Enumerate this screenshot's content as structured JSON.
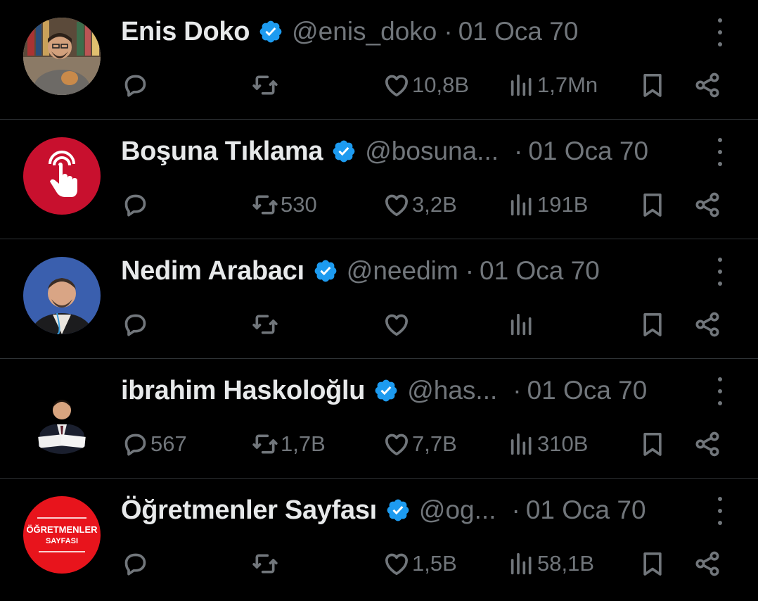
{
  "colors": {
    "background": "#000000",
    "text_primary": "#e7e9ea",
    "text_secondary": "#71767b",
    "verified": "#1d9bf0",
    "divider": "#2f3336"
  },
  "tweets": [
    {
      "name": "Enis Doko",
      "handle": "@enis_doko",
      "separator": "·",
      "date": "01 Oca 70",
      "avatar": "person-photo-bookshelf",
      "replies": "",
      "retweets": "",
      "likes": "10,8B",
      "views": "1,7Mn"
    },
    {
      "name": "Boşuna Tıklama",
      "handle": "@bosuna...",
      "separator": "·",
      "date": "01 Oca 70",
      "avatar": "red-hand-click-logo",
      "replies": "",
      "retweets": "530",
      "likes": "3,2B",
      "views": "191B"
    },
    {
      "name": "Nedim Arabacı",
      "handle": "@needim",
      "separator": "·",
      "date": "01 Oca 70",
      "avatar": "person-photo-blue-background",
      "replies": "",
      "retweets": "",
      "likes": "",
      "views": ""
    },
    {
      "name": "ibrahim Haskoloğlu",
      "handle": "@has...",
      "separator": "·",
      "date": "01 Oca 70",
      "avatar": "person-photo-podium",
      "replies": "567",
      "retweets": "1,7B",
      "likes": "7,7B",
      "views": "310B"
    },
    {
      "name": "Öğretmenler Sayfası",
      "handle": "@og...",
      "separator": "·",
      "date": "01 Oca 70",
      "avatar": "ogretmenler-sayfasi-logo",
      "logo_text": [
        "ÖĞRETMENLER",
        "SAYFASI"
      ],
      "replies": "",
      "retweets": "",
      "likes": "1,5B",
      "views": "58,1B"
    }
  ]
}
